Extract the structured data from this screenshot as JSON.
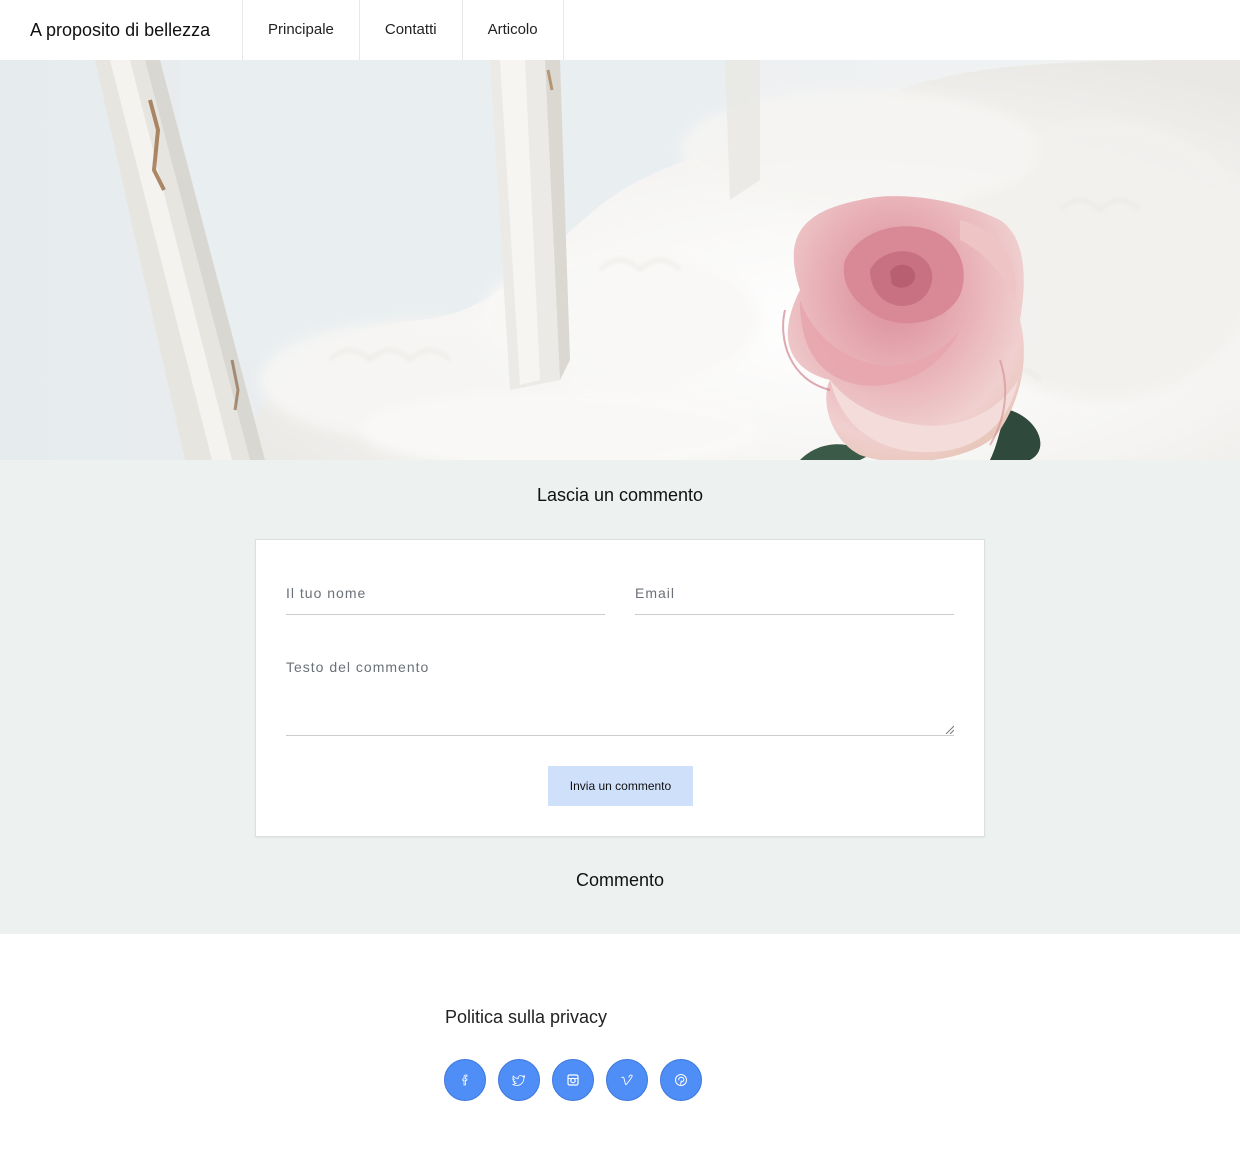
{
  "header": {
    "brand": "A proposito di bellezza",
    "nav": [
      {
        "label": "Principale"
      },
      {
        "label": "Contatti"
      },
      {
        "label": "Articolo"
      }
    ]
  },
  "comment_form": {
    "title": "Lascia un commento",
    "name_placeholder": "Il tuo nome",
    "email_placeholder": "Email",
    "text_placeholder": "Testo del commento",
    "submit_label": "Invia un commento"
  },
  "comments": {
    "title": "Commento"
  },
  "footer": {
    "privacy_label": "Politica sulla privacy",
    "socials": [
      "facebook-icon",
      "twitter-icon",
      "instagram-icon",
      "vimeo-icon",
      "pinterest-icon"
    ]
  },
  "colors": {
    "social_bg": "#4f8ef7",
    "section_bg": "#edf2f1",
    "button_bg": "#cfe0fb"
  }
}
